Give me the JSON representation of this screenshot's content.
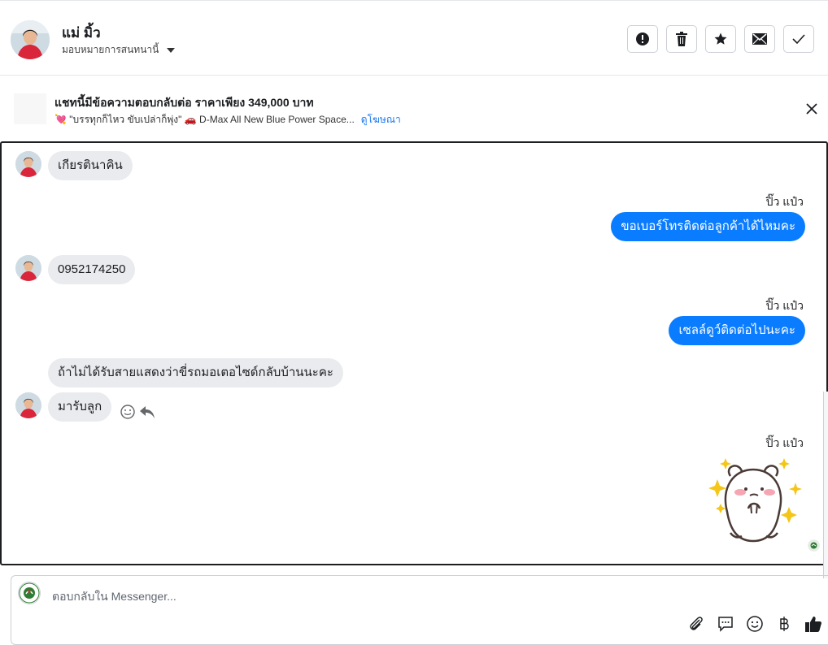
{
  "header": {
    "contact_name": "แม่ มิ้ว",
    "assign_label": "มอบหมายการสนทนานี้",
    "actions": [
      "mark-spam",
      "delete",
      "star",
      "mark-unread",
      "mark-done"
    ]
  },
  "ad_banner": {
    "title": "แชทนี้มีข้อความตอบกลับต่อ ราคาเพียง 349,000 บาท",
    "description": "💘 \"บรรทุกก็ไหว ขับเปล่าก็พุ่ง\" 🚗 D-Max All New Blue Power Space...",
    "link_label": "ดูโฆษณา"
  },
  "messages": [
    {
      "dir": "in",
      "text": "เกียรตินาคิน"
    },
    {
      "dir": "out",
      "sender": "ปิ๊ว แป๋ว",
      "text": "ขอเบอร์โทรติดต่อลูกค้าได้ไหมคะ"
    },
    {
      "dir": "in",
      "text": "0952174250"
    },
    {
      "dir": "out",
      "sender": "ปิ๊ว แป๋ว",
      "text": "เซลล์ดูว์ติดต่อไปนะคะ"
    },
    {
      "dir": "in",
      "text": "ถ้าไม่ได้รับสายแสดงว่าขี่รถมอเตอไซด์กลับบ้านนะคะ"
    },
    {
      "dir": "in",
      "text": "มารับลูก"
    },
    {
      "dir": "out",
      "sender": "ปิ๊ว แป๋ว",
      "sticker": "hamster-sticker"
    }
  ],
  "composer": {
    "placeholder": "ตอบกลับใน Messenger...",
    "tools": [
      "attach-icon",
      "saved-replies-icon",
      "emoji-icon",
      "baht-icon",
      "like-icon"
    ]
  },
  "colors": {
    "accent": "#0a7cff",
    "incoming_bubble": "#e9ebee",
    "border": "#ccd0d5"
  }
}
